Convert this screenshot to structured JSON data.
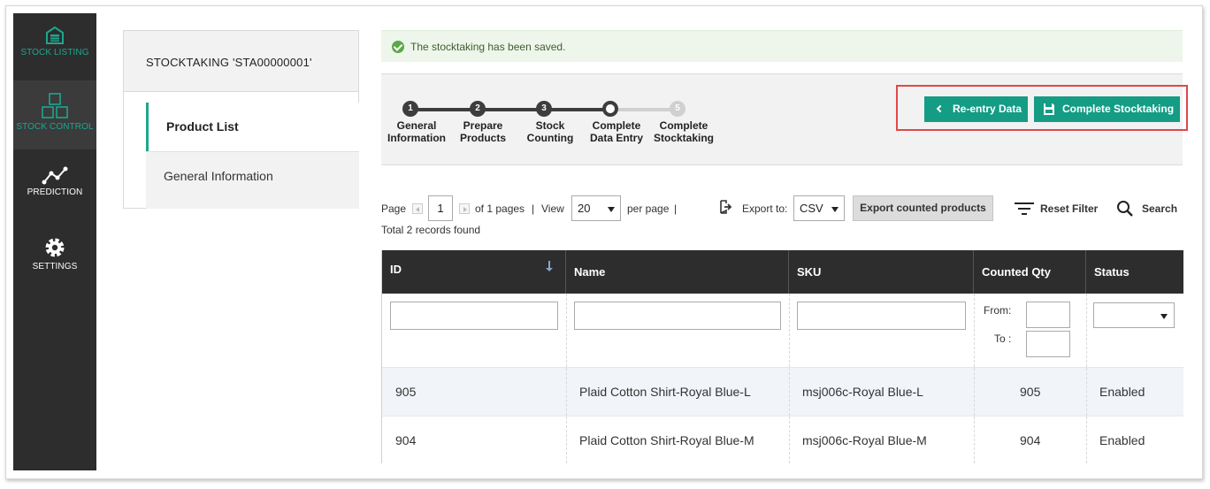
{
  "sidebar": {
    "items": [
      {
        "label": "STOCK LISTING",
        "icon": "warehouse-icon"
      },
      {
        "label": "STOCK CONTROL",
        "icon": "boxes-icon"
      },
      {
        "label": "PREDICTION",
        "icon": "trend-chart-icon"
      },
      {
        "label": "SETTINGS",
        "icon": "gear-icon"
      }
    ],
    "accent": "#1fa58e"
  },
  "left_panel": {
    "title": "STOCKTAKING 'STA00000001'",
    "tabs": [
      {
        "label": "Product List",
        "active": true
      },
      {
        "label": "General Information",
        "active": false
      }
    ]
  },
  "notice": {
    "message": "The stocktaking has been saved."
  },
  "steps": [
    {
      "number": "1",
      "line1": "General",
      "line2": "Information",
      "state": "done"
    },
    {
      "number": "2",
      "line1": "Prepare",
      "line2": "Products",
      "state": "done"
    },
    {
      "number": "3",
      "line1": "Stock",
      "line2": "Counting",
      "state": "done"
    },
    {
      "number": "4",
      "line1": "Complete",
      "line2": "Data Entry",
      "state": "current"
    },
    {
      "number": "5",
      "line1": "Complete",
      "line2": "Stocktaking",
      "state": "pending"
    }
  ],
  "actions": {
    "reentry_label": "Re-entry Data",
    "complete_label": "Complete Stocktaking",
    "button_color": "#149c85"
  },
  "toolbar": {
    "page_label": "Page",
    "page_value": "1",
    "of_pages": "of 1 pages",
    "sep1": "|",
    "view_label": "View",
    "per_page_value": "20",
    "per_page_label": "per page",
    "sep2": "|",
    "records_found": "Total 2 records found",
    "export_to_label": "Export to:",
    "export_format": "CSV",
    "export_button": "Export counted products",
    "reset_filter": "Reset Filter",
    "search": "Search"
  },
  "table": {
    "columns": [
      "ID",
      "Name",
      "SKU",
      "Counted Qty",
      "Status"
    ],
    "filter_from": "From:",
    "filter_to": "To :",
    "rows": [
      {
        "id": "905",
        "name": "Plaid Cotton Shirt-Royal Blue-L",
        "sku": "msj006c-Royal Blue-L",
        "qty": "905",
        "status": "Enabled"
      },
      {
        "id": "904",
        "name": "Plaid Cotton Shirt-Royal Blue-M",
        "sku": "msj006c-Royal Blue-M",
        "qty": "904",
        "status": "Enabled"
      }
    ]
  }
}
